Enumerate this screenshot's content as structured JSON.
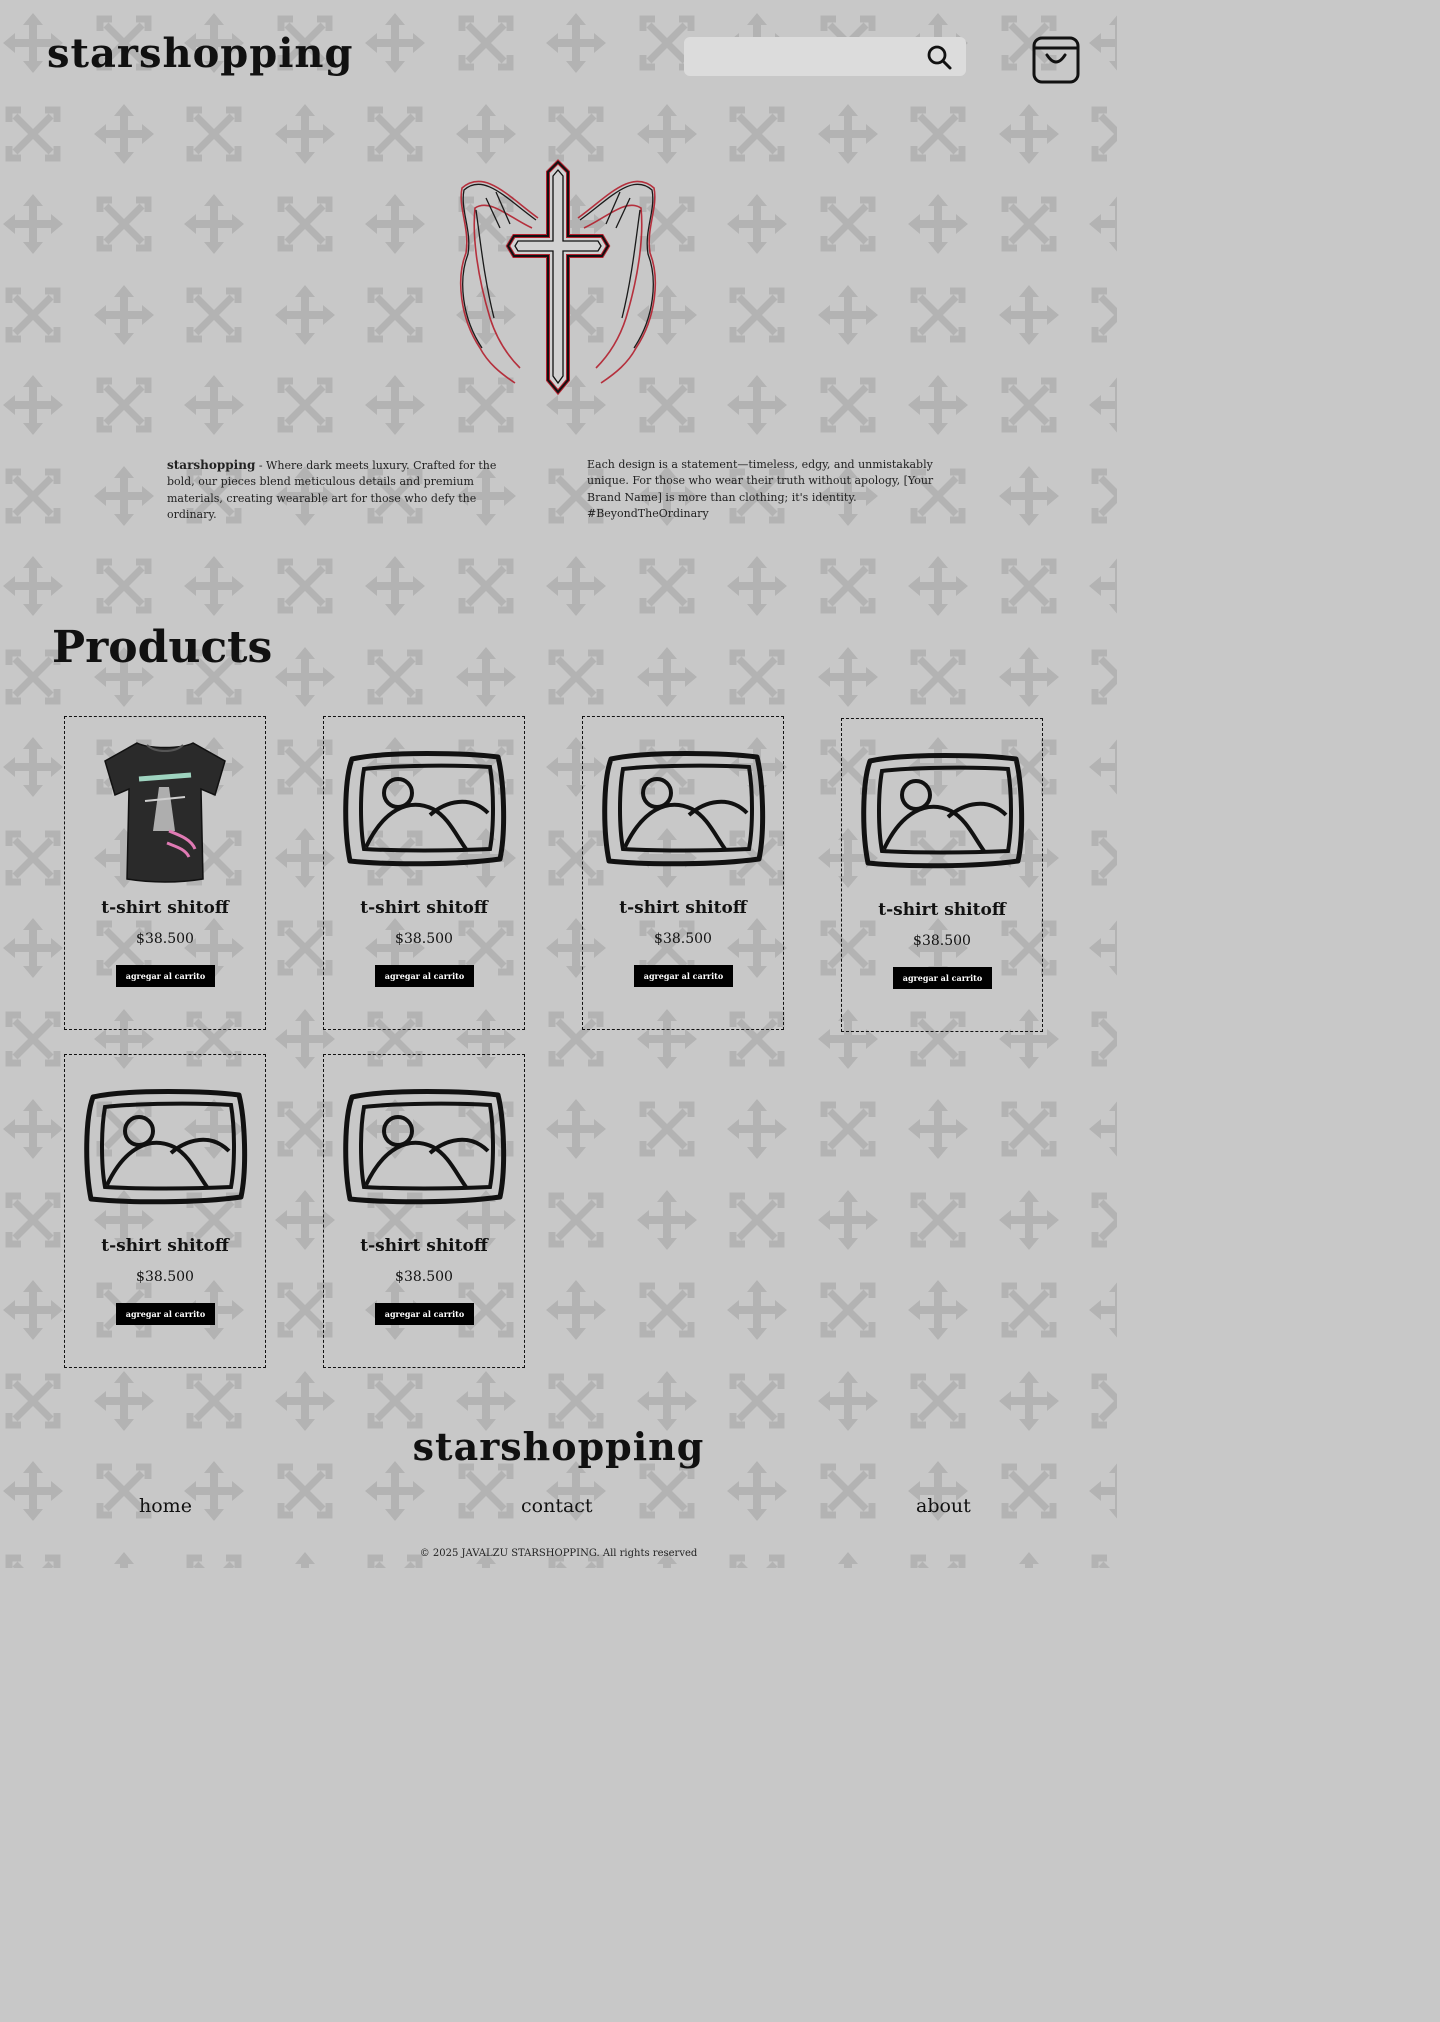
{
  "header": {
    "logo": "starshopping",
    "search_placeholder": ""
  },
  "about": {
    "left_brand": "starshopping",
    "left_text": " - Where dark  meets luxury. Crafted for the bold, our pieces blend meticulous details and premium materials, creating wearable art for those who defy the ordinary.",
    "right_text": "Each design is a statement—timeless, edgy, and unmistakably unique. For those who wear their truth without apology, [Your Brand Name] is more than clothing; it's identity. #BeyondTheOrdinary"
  },
  "products": {
    "title": "Products",
    "items": [
      {
        "name": "t-shirt shitoff",
        "price": "$38.500",
        "button": "agregar al carrito",
        "image": "tshirt-image"
      },
      {
        "name": "t-shirt shitoff",
        "price": "$38.500",
        "button": "agregar al carrito",
        "image": "image-placeholder-icon"
      },
      {
        "name": "t-shirt shitoff",
        "price": "$38.500",
        "button": "agregar al carrito",
        "image": "image-placeholder-icon"
      },
      {
        "name": "t-shirt shitoff",
        "price": "$38.500",
        "button": "agregar al carrito",
        "image": "image-placeholder-icon"
      },
      {
        "name": "t-shirt shitoff",
        "price": "$38.500",
        "button": "agregar al carrito",
        "image": "image-placeholder-icon"
      },
      {
        "name": "t-shirt shitoff",
        "price": "$38.500",
        "button": "agregar al carrito",
        "image": "image-placeholder-icon"
      }
    ]
  },
  "footer": {
    "logo": "starshopping",
    "links": [
      "home",
      "contact",
      "about"
    ],
    "copyright": "© 2025 JAVALZU STARSHOPPING. All rights reserved"
  },
  "icons": {
    "search": "search-icon",
    "cart": "shopping-bag-icon",
    "hero": "winged-cross-icon",
    "background": "arrow-cross-pattern"
  },
  "colors": {
    "background": "#c8c8c8",
    "pattern": "#b3b3b3",
    "button": "#000000",
    "hero_accent": "#b3202e"
  }
}
